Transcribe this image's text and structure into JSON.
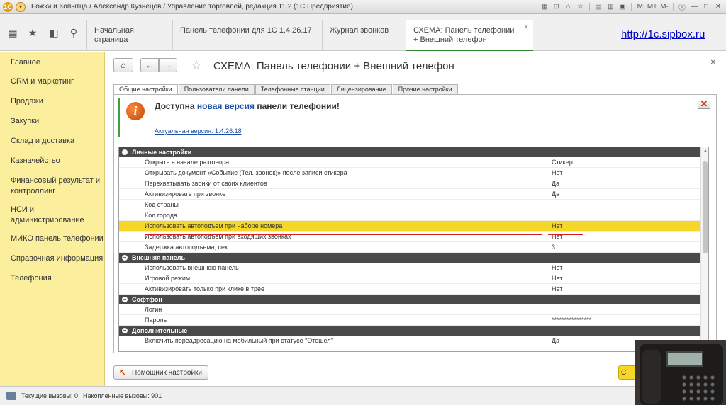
{
  "window": {
    "title": "Рожки и Копытца / Александр Кузнецов / Управление торговлей, редакция 11.2  (1С:Предприятие)",
    "logo": "1С",
    "right_buttons": [
      "M",
      "M+",
      "M-"
    ]
  },
  "topnav": {
    "tabs": [
      {
        "label": "Начальная страница"
      },
      {
        "label": "Панель телефонии для 1С 1.4.26.17"
      },
      {
        "label": "Журнал звонков"
      },
      {
        "label": "СХЕМА: Панель телефонии + Внешний телефон",
        "active": true
      }
    ],
    "site_link": "http://1c.sipbox.ru"
  },
  "sidebar": {
    "items": [
      {
        "label": "Главное"
      },
      {
        "label": "CRM и маркетинг"
      },
      {
        "label": "Продажи"
      },
      {
        "label": "Закупки"
      },
      {
        "label": "Склад и доставка"
      },
      {
        "label": "Казначейство"
      },
      {
        "label": "Финансовый результат и контроллинг"
      },
      {
        "label": "НСИ и администрирование"
      },
      {
        "label": "МИКО панель телефонии"
      },
      {
        "label": "Справочная информация"
      },
      {
        "label": "Телефония"
      }
    ]
  },
  "form": {
    "title": "СХЕМА: Панель телефонии + Внешний телефон",
    "tabs": [
      "Общие настройки",
      "Пользователи панели",
      "Телефонные станции",
      "Лицензирование",
      "Прочие настройки"
    ],
    "notice": {
      "prefix": "Доступна",
      "link": "новая версия",
      "suffix": "панели телефонии!",
      "version": "Актуальная версия: 1.4.26.18"
    },
    "groups": [
      {
        "title": "Личные настройки",
        "rows": [
          {
            "name": "Открыть в начале разговора",
            "value": "Стикер"
          },
          {
            "name": "Открывать документ «Событие (Тел. звонок)» после записи стикера",
            "value": "Нет"
          },
          {
            "name": "Перехватывать звонки от своих клиентов",
            "value": "Да"
          },
          {
            "name": "Активизировать при звонке",
            "value": "Да"
          },
          {
            "name": "Код страны",
            "value": ""
          },
          {
            "name": "Код города",
            "value": ""
          },
          {
            "name": "Использовать автоподъем при наборе номера",
            "value": "Нет"
          },
          {
            "name": "Использовать автоподъем при входящих звонках",
            "value": "Нет"
          },
          {
            "name": "Задержка автоподъема, сек.",
            "value": "3"
          }
        ]
      },
      {
        "title": "Внешняя панель",
        "rows": [
          {
            "name": "Использовать внешнюю панель",
            "value": "Нет"
          },
          {
            "name": "Игровой режим",
            "value": "Нет"
          },
          {
            "name": "Активизировать только при клике в трее",
            "value": "Нет"
          }
        ]
      },
      {
        "title": "Софтфон",
        "rows": [
          {
            "name": "Логин",
            "value": ""
          },
          {
            "name": "Пароль",
            "value": "****************"
          }
        ]
      },
      {
        "title": "Дополнительные",
        "rows": [
          {
            "name": "Включить переадресацию на мобильный при статусе \"Отошел\"",
            "value": "Да"
          }
        ]
      }
    ],
    "wizard_button": "Помощник настройки",
    "save_button": "С"
  },
  "status": {
    "current": "Текущие вызовы: 0",
    "accumulated": "Накопленные вызовы: 901"
  },
  "colors": {
    "sidebar": "#fbef9e",
    "selected_row": "#f6d626",
    "group_header": "#4a4a4a",
    "active_tab_underline": "#2c8a2c",
    "link": "#1a4fa5",
    "annotation_underline": "#d52020"
  },
  "icons": [
    "grid-icon",
    "star-icon",
    "history-icon",
    "search-icon",
    "home-icon",
    "back-icon",
    "forward-icon",
    "info-icon",
    "close-icon",
    "wizard-icon"
  ]
}
